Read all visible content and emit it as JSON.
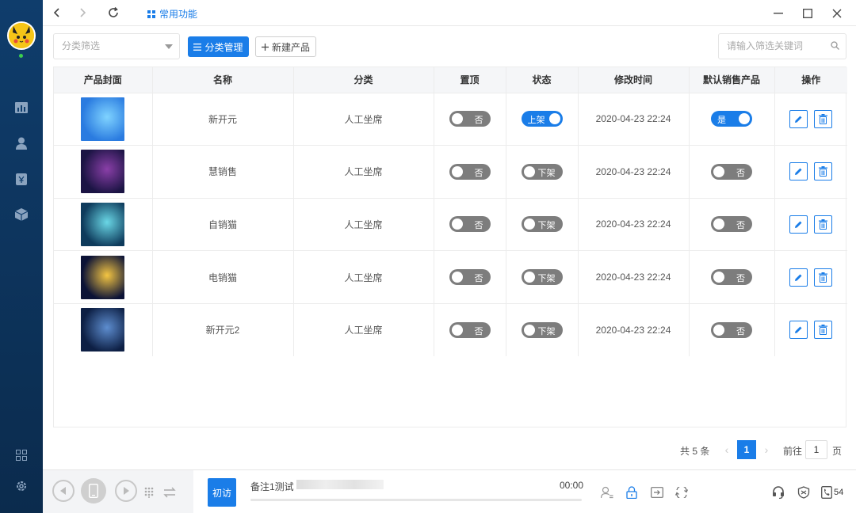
{
  "titlebar": {
    "tab_title": "常用功能"
  },
  "toolbar": {
    "category_filter_placeholder": "分类筛选",
    "category_manage_label": "分类管理",
    "new_product_label": "新建产品",
    "search_placeholder": "请输入筛选关键词"
  },
  "table": {
    "columns": [
      "产品封面",
      "名称",
      "分类",
      "置顶",
      "状态",
      "修改时间",
      "默认销售产品",
      "操作"
    ],
    "rows": [
      {
        "name": "新开元",
        "category": "人工坐席",
        "pin": "否",
        "pin_on": false,
        "status": "上架",
        "status_on": true,
        "modified": "2020-04-23 22:24",
        "default": "是",
        "default_on": true,
        "cover_colors": [
          "#2a7be0",
          "#7fd3ff"
        ]
      },
      {
        "name": "慧销售",
        "category": "人工坐席",
        "pin": "否",
        "pin_on": false,
        "status": "下架",
        "status_on": false,
        "modified": "2020-04-23 22:24",
        "default": "否",
        "default_on": false,
        "cover_colors": [
          "#1b1444",
          "#8a3fa8"
        ]
      },
      {
        "name": "自销猫",
        "category": "人工坐席",
        "pin": "否",
        "pin_on": false,
        "status": "下架",
        "status_on": false,
        "modified": "2020-04-23 22:24",
        "default": "否",
        "default_on": false,
        "cover_colors": [
          "#0e3b5c",
          "#6ad7e6"
        ]
      },
      {
        "name": "电销猫",
        "category": "人工坐席",
        "pin": "否",
        "pin_on": false,
        "status": "下架",
        "status_on": false,
        "modified": "2020-04-23 22:24",
        "default": "否",
        "default_on": false,
        "cover_colors": [
          "#0b1236",
          "#f4c542"
        ]
      },
      {
        "name": "新开元2",
        "category": "人工坐席",
        "pin": "否",
        "pin_on": false,
        "status": "下架",
        "status_on": false,
        "modified": "2020-04-23 22:24",
        "default": "否",
        "default_on": false,
        "cover_colors": [
          "#0d1f44",
          "#5d8dcf"
        ]
      }
    ]
  },
  "pager": {
    "total": "共 5 条",
    "current_page": "1",
    "goto_label": "前往",
    "goto_value": "1",
    "unit": "页"
  },
  "bottombar": {
    "visit_label": "初访",
    "remark": "备注1测试",
    "timer": "00:00",
    "badge_count": "54"
  },
  "colors": {
    "accent": "#1a7de8",
    "sidebar": "#0f3d6c",
    "toggle_off": "#7d7d7d"
  }
}
